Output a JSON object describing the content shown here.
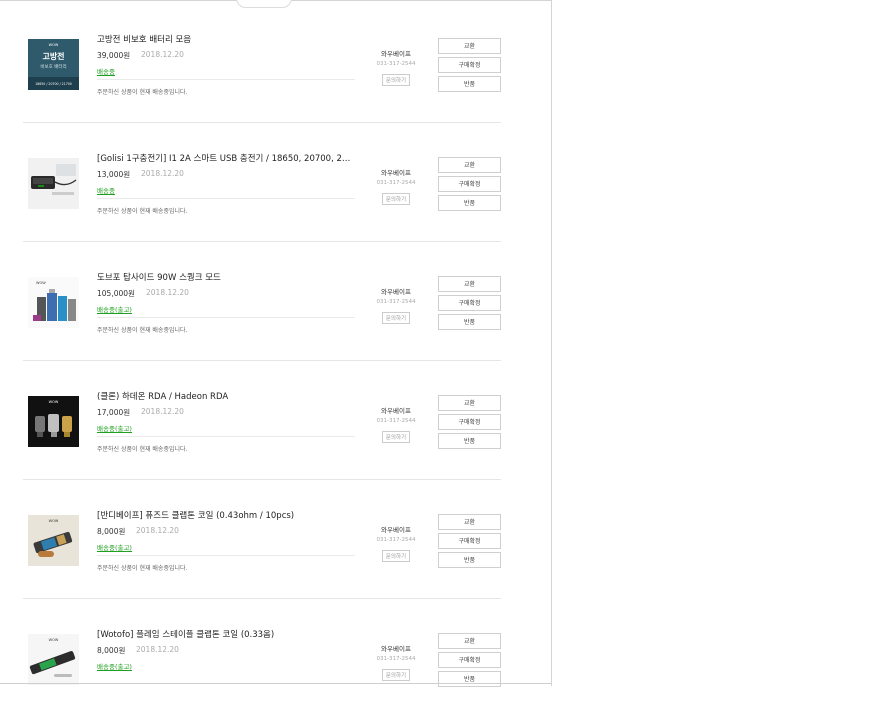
{
  "orders": [
    {
      "name": "고방전 비보호 배터리 모음",
      "price": "39,000원",
      "date": "2018.12.20",
      "status": "배송중",
      "message": "주문하신 상품이 현재 배송중입니다.",
      "thumb_text": {
        "logo": "WOW",
        "title": "고방전",
        "sub": "비보호 배터리",
        "bottom": "18650 / 20700 / 21700"
      }
    },
    {
      "name": "[Golisi 1구충전기] I1 2A 스마트 USB 충전기 / 18650, 20700, 2…",
      "price": "13,000원",
      "date": "2018.12.20",
      "status": "배송중",
      "message": "주문하신 상품이 현재 배송중입니다."
    },
    {
      "name": "도브포 탑사이드 90W 스퀑크 모드",
      "price": "105,000원",
      "date": "2018.12.20",
      "status": "배송중(출고)",
      "message": "주문하신 상품이 현재 배송중입니다.",
      "thumb_text": {
        "logo": "WOW"
      }
    },
    {
      "name": "(클론) 하데온 RDA / Hadeon RDA",
      "price": "17,000원",
      "date": "2018.12.20",
      "status": "배송중(출고)",
      "message": "주문하신 상품이 현재 배송중입니다.",
      "thumb_text": {
        "logo": "WOW"
      }
    },
    {
      "name": "[반디베이프] 퓨즈드 클랩톤 코일 (0.43ohm / 10pcs)",
      "price": "8,000원",
      "date": "2018.12.20",
      "status": "배송중(출고)",
      "message": "주문하신 상품이 현재 배송중입니다.",
      "thumb_text": {
        "logo": "WOW"
      }
    },
    {
      "name": "[Wotofo] 플레임 스테이플 클랩톤 코일 (0.33옴)",
      "price": "8,000원",
      "date": "2018.12.20",
      "status": "배송중(출고)",
      "message": "",
      "thumb_text": {
        "logo": "WOW"
      }
    }
  ],
  "seller": {
    "name": "와우베이프",
    "phone": "031-317-2544",
    "inquiry_label": "문의하기"
  },
  "actions": {
    "exchange": "교환",
    "confirm": "구매확정",
    "return": "반품"
  },
  "colors": {
    "status_green": "#20a020",
    "date_gray": "#aaaaaa",
    "thumb1_bg": "#2f5a6b"
  }
}
